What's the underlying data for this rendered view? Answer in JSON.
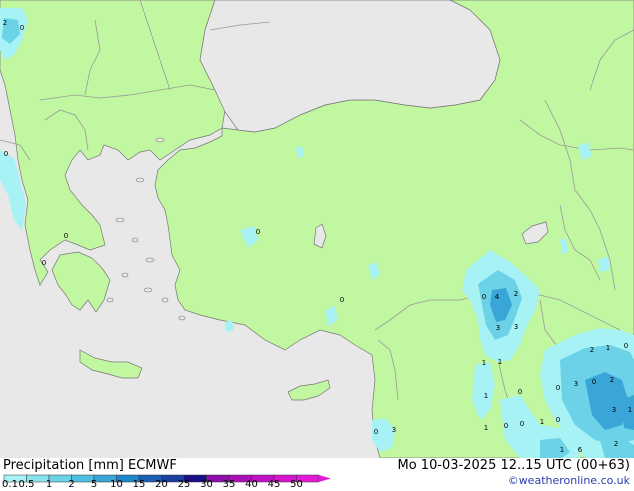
{
  "title": {
    "left": "Precipitation [mm]  ECMWF",
    "right": "Mo 10-03-2025 12..15 UTC (00+63)"
  },
  "credit": "©weatheronline.co.uk",
  "legend": {
    "labels": [
      "0.1",
      "0.5",
      "1",
      "2",
      "5",
      "10",
      "15",
      "20",
      "25",
      "30",
      "35",
      "40",
      "45",
      "50"
    ],
    "colors": [
      "#a6f2f5",
      "#8ae3ef",
      "#6cd2e8",
      "#4fbfe1",
      "#3aa6d8",
      "#1e86c9",
      "#1b5fb5",
      "#1a3fa0",
      "#180f88",
      "#8d0ea8",
      "#aa10b8",
      "#c212c6",
      "#d515d0",
      "#e419d8"
    ]
  },
  "colors": {
    "sea": "#e8e8e8",
    "land_rain": "#c1f7a0",
    "land_dry": "#e8e8e8",
    "border": "#9a9a9a",
    "coast": "#777777"
  },
  "map_values": [
    "2",
    "0",
    "0",
    "0",
    "0",
    "0",
    "0",
    "4",
    "2",
    "0",
    "3",
    "3",
    "1",
    "1",
    "1",
    "0",
    "1",
    "0",
    "0",
    "1",
    "0",
    "2",
    "1",
    "0",
    "0",
    "3",
    "0",
    "2",
    "3",
    "1",
    "2",
    "0",
    "3",
    "1",
    "6"
  ]
}
